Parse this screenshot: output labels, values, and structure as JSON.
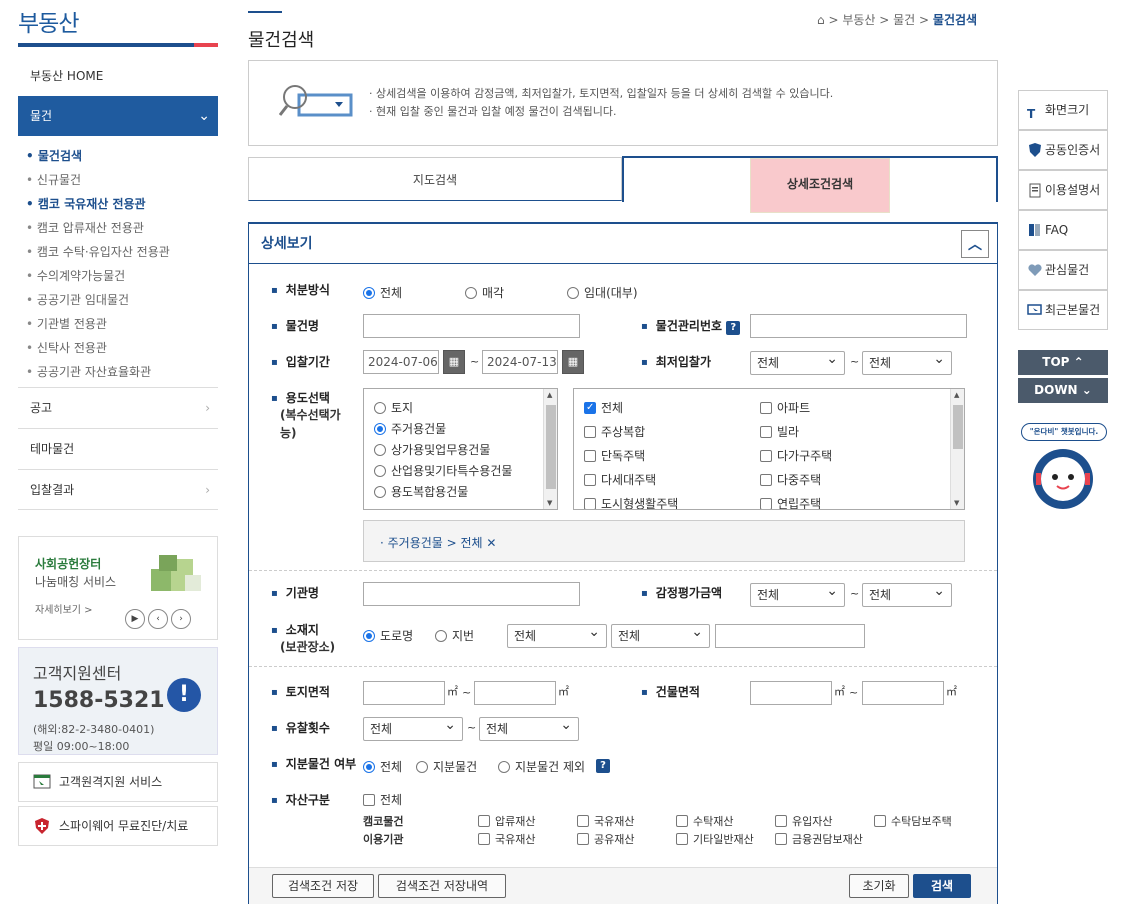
{
  "sidebar": {
    "brand": "부동산",
    "home": "부동산 HOME",
    "active": "물건",
    "subitems": [
      "물건검색",
      "신규물건",
      "캠코 국유재산 전용관",
      "캠코 압류재산 전용관",
      "캠코 수탁·유입자산 전용관",
      "수의계약가능물건",
      "공공기관 임대물건",
      "기관별 전용관",
      "신탁사 전용관",
      "공공기관 자산효율화관"
    ],
    "items": [
      "공고",
      "테마물건",
      "입찰결과"
    ],
    "promo": {
      "line1": "사회공헌장터",
      "line2": "나눔매칭 서비스",
      "more": "자세히보기 >"
    },
    "cs": {
      "title": "고객지원센터",
      "phone": "1588-5321",
      "overseas": "(해외:82-2-3480-0401)",
      "hours": "평일 09:00~18:00"
    },
    "remote": "고객원격지원 서비스",
    "spyware": "스파이웨어 무료진단/치료"
  },
  "page": {
    "title": "물건검색",
    "breadcrumb": [
      "부동산",
      "물건",
      "물건검색"
    ],
    "intro": [
      "· 상세검색을 이용하여 감정금액, 최저입찰가, 토지면적, 입찰일자 등을 더 상세히 검색할 수 있습니다.",
      "· 현재 입찰 중인 물건과 입찰 예정 물건이 검색됩니다."
    ],
    "tabs": [
      "지도검색",
      "상세조건검색"
    ]
  },
  "form": {
    "panel_title": "상세보기",
    "disposal": {
      "label": "처분방식",
      "options": [
        "전체",
        "매각",
        "임대(대부)"
      ]
    },
    "name_label": "물건명",
    "mgmt_label": "물건관리번호",
    "period": {
      "label": "입찰기간",
      "from": "2024-07-06",
      "to": "2024-07-13",
      "sep": "~"
    },
    "minbid": {
      "label": "최저입찰가",
      "from": "전체",
      "to": "전체"
    },
    "usage": {
      "label1": "용도선택",
      "label2": "(복수선택가",
      "label3": "능)",
      "left": [
        "토지",
        "주거용건물",
        "상가용및업무용건물",
        "산업용및기타특수용건물",
        "용도복합용건물"
      ],
      "right_col1": [
        "전체",
        "주상복합",
        "단독주택",
        "다세대주택",
        "도시형생활주택"
      ],
      "right_col2": [
        "아파트",
        "빌라",
        "다가구주택",
        "다중주택",
        "연립주택"
      ],
      "selected_path": "· 주거용건물 > 전체"
    },
    "agency_label": "기관명",
    "appraisal": {
      "label": "감정평가금액",
      "from": "전체",
      "to": "전체"
    },
    "location": {
      "label1": "소재지",
      "label2": "(보관장소)",
      "opt1": "도로명",
      "opt2": "지번",
      "sel1": "전체",
      "sel2": "전체"
    },
    "land": {
      "label": "토지면적",
      "unit": "㎡"
    },
    "building": {
      "label": "건물면적",
      "unit": "㎡"
    },
    "failcount": {
      "label": "유찰횟수",
      "from": "전체",
      "to": "전체"
    },
    "share": {
      "label": "지분물건 여부",
      "options": [
        "전체",
        "지분물건",
        "지분물건 제외"
      ]
    },
    "asset": {
      "label": "자산구분",
      "all": "전체",
      "row1_label": "캠코물건",
      "row1": [
        "압류재산",
        "국유재산",
        "수탁재산",
        "유입자산",
        "수탁담보주택"
      ],
      "row2_label": "이용기관",
      "row2": [
        "국유재산",
        "공유재산",
        "기타일반재산",
        "금융권담보재산"
      ]
    },
    "buttons": {
      "save": "검색조건 저장",
      "history": "검색조건 저장내역",
      "reset": "초기화",
      "search": "검색"
    }
  },
  "rail": {
    "items": [
      "화면크기",
      "공동인증서",
      "이용설명서",
      "FAQ",
      "관심물건",
      "최근본물건"
    ],
    "top": "TOP ⌃",
    "down": "DOWN ⌄",
    "chatbot": "\"온다비\" 챗봇입니다."
  }
}
